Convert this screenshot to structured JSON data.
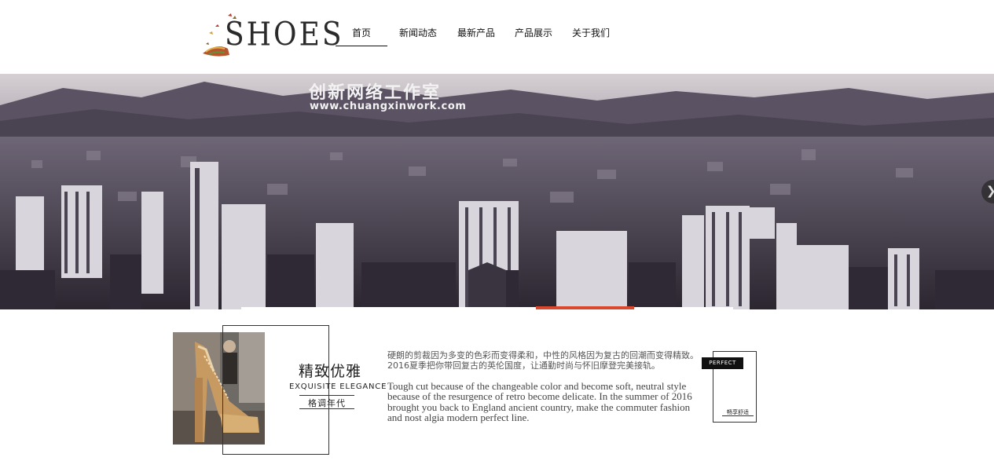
{
  "header": {
    "logo_text": "SHOES",
    "nav": [
      {
        "label": "首页",
        "active": true
      },
      {
        "label": "新闻动态",
        "active": false
      },
      {
        "label": "最新产品",
        "active": false
      },
      {
        "label": "产品展示",
        "active": false
      },
      {
        "label": "关于我们",
        "active": false
      }
    ]
  },
  "banner": {
    "title": "创新网络工作室",
    "url": "www.chuangxinwork.com",
    "next_icon": "chevron-right-icon",
    "active_slide_color": "#d9472f"
  },
  "feature": {
    "cn_title": "精致优雅",
    "en_title": "EXQUISITE ELEGANCE",
    "tag": "格调年代",
    "desc_cn": "硬朗的剪裁因为多变的色彩而变得柔和，中性的风格因为复古的回潮而变得精致。2016夏季把你带回复古的英伦国度，让通勤时尚与怀旧摩登完美接轨。",
    "desc_en": "Tough cut because of the changeable color and become soft, neutral style because of the resurgence of retro become delicate. In the summer of 2016 brought you back to England ancient country, make the commuter fashion and nost algia modern perfect line.",
    "badge": "PERFECT",
    "badge_caption": "畅享舒适"
  }
}
